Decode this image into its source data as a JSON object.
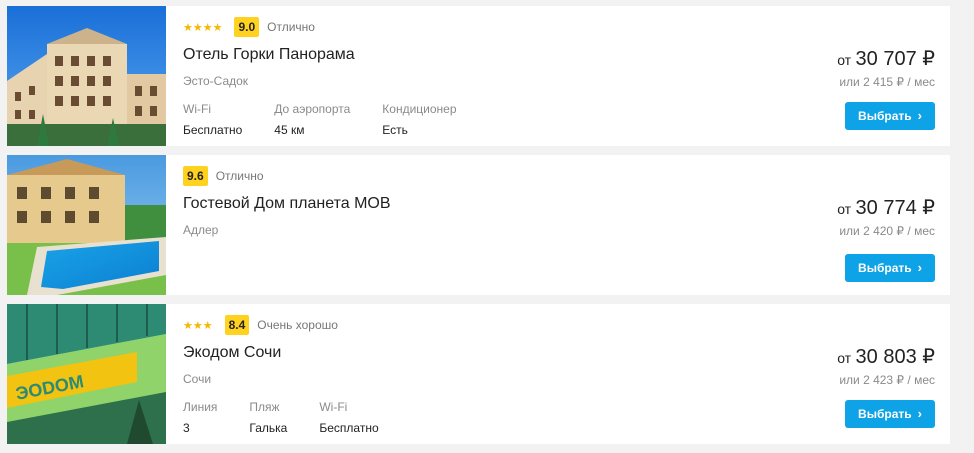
{
  "hotels": [
    {
      "stars": "★★★★",
      "score": "9.0",
      "score_label": "Отлично",
      "name": "Отель Горки Панорама",
      "location": "Эсто-Садок",
      "features": [
        {
          "label": "Wi-Fi",
          "value": "Бесплатно"
        },
        {
          "label": "До аэропорта",
          "value": "45 км"
        },
        {
          "label": "Кондиционер",
          "value": "Есть"
        }
      ],
      "price_prefix": "от",
      "price": "30 707 ₽",
      "monthly": "или 2 415 ₽ / мес",
      "button": "Выбрать"
    },
    {
      "stars": "",
      "score": "9.6",
      "score_label": "Отлично",
      "name": "Гостевой Дом планета МОВ",
      "location": "Адлер",
      "features": [],
      "price_prefix": "от",
      "price": "30 774 ₽",
      "monthly": "или 2 420 ₽ / мес",
      "button": "Выбрать"
    },
    {
      "stars": "★★★",
      "score": "8.4",
      "score_label": "Очень хорошо",
      "name": "Экодом Сочи",
      "location": "Сочи",
      "features": [
        {
          "label": "Линия",
          "value": "3"
        },
        {
          "label": "Пляж",
          "value": "Галька"
        },
        {
          "label": "Wi-Fi",
          "value": "Бесплатно"
        }
      ],
      "price_prefix": "от",
      "price": "30 803 ₽",
      "monthly": "или 2 423 ₽ / мес",
      "button": "Выбрать"
    }
  ],
  "colors": {
    "accent_button": "#0ea2e6",
    "score_badge": "#ffd21f",
    "star": "#f5b800"
  },
  "icons": {
    "button_chevron": "chevron-right-icon",
    "star": "star-icon"
  }
}
